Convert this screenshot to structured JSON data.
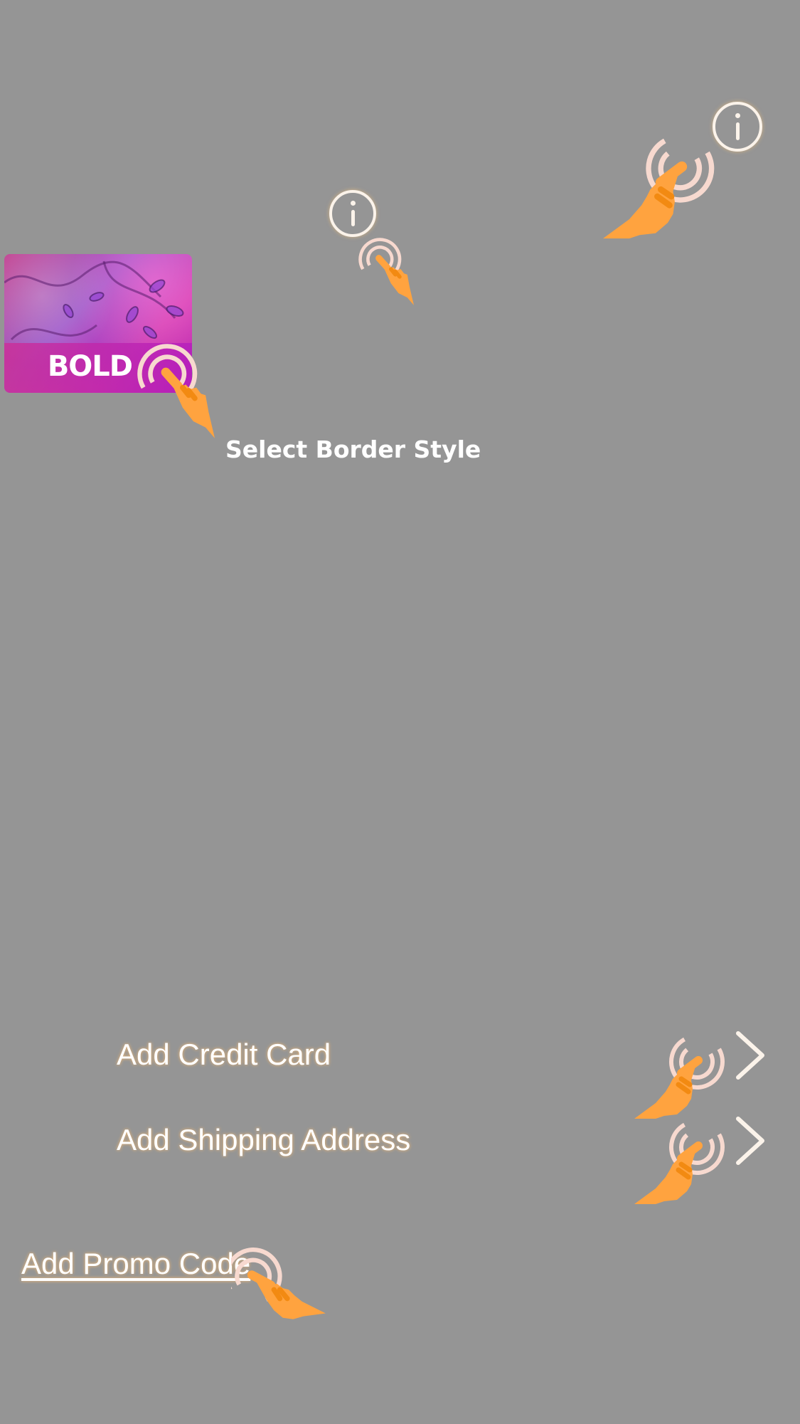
{
  "screen": {
    "background_color": "#959595"
  },
  "header": {
    "info_icon": "info-icon"
  },
  "card_style": {
    "info_icon": "info-icon",
    "selected_label": "BOLD"
  },
  "border_style": {
    "title": "Select Border Style"
  },
  "menu": {
    "items": [
      {
        "label": "Add Credit Card",
        "icon": "chevron-right-icon"
      },
      {
        "label": "Add Shipping Address",
        "icon": "chevron-right-icon"
      }
    ]
  },
  "promo": {
    "label": "Add Promo Code"
  },
  "hints": {
    "icon": "tap-hand-icon",
    "hand_color": "#FFA33F",
    "ripple_color": "#F7D9CF"
  }
}
